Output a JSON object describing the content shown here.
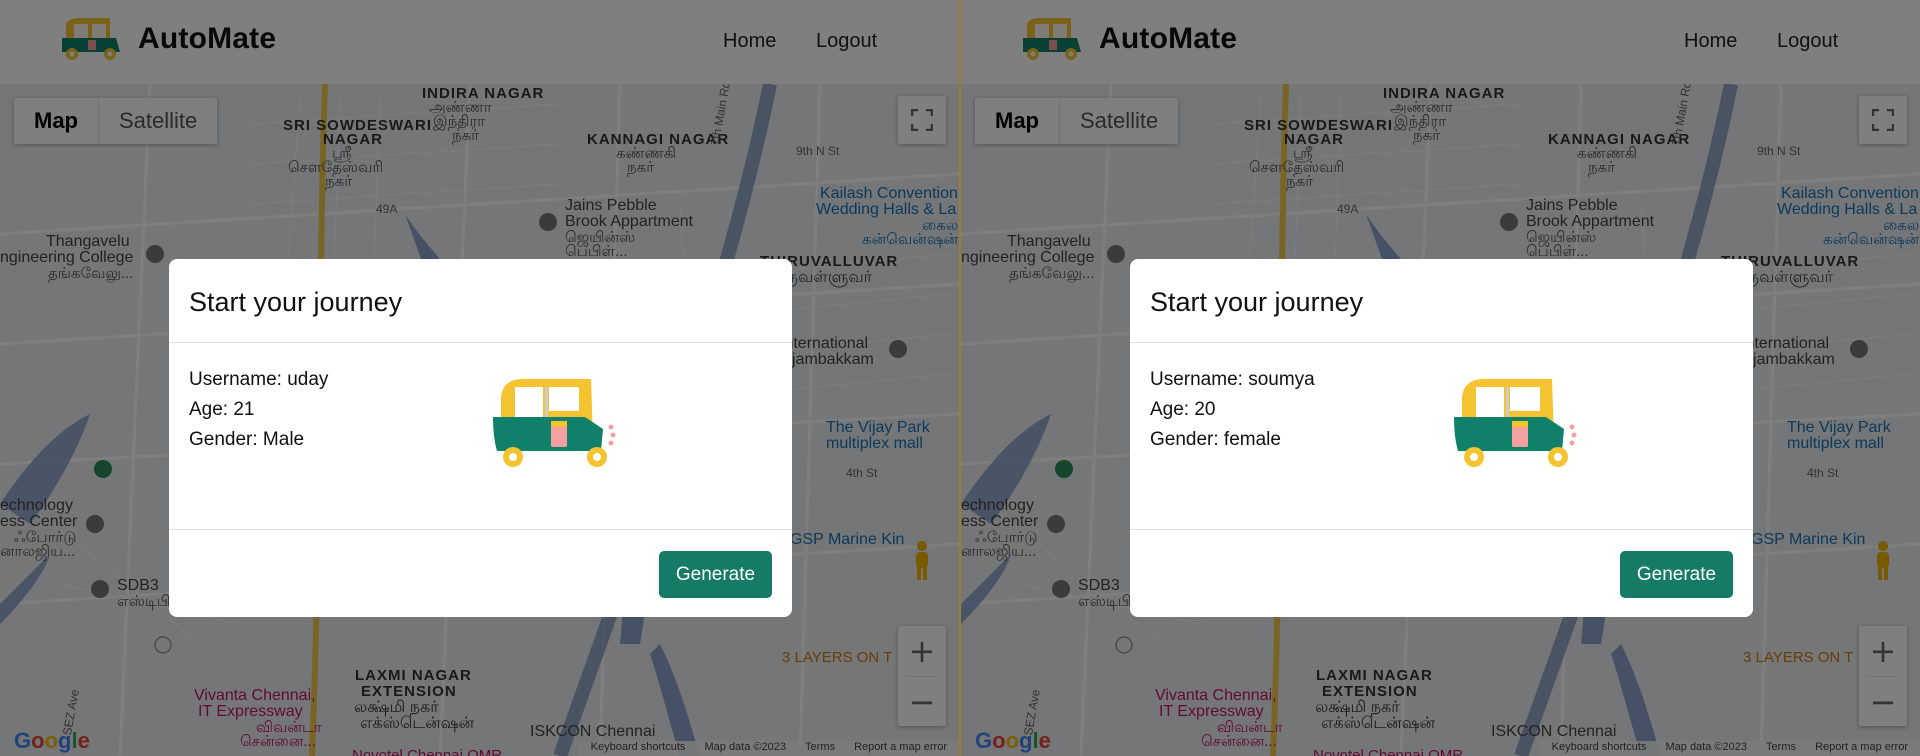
{
  "app": {
    "brand": "AutoMate",
    "nav": {
      "home": "Home",
      "logout": "Logout"
    },
    "accent_color": "#157a66"
  },
  "map": {
    "type_map": "Map",
    "type_satellite": "Satellite",
    "google_logo": "Google",
    "zoom_in": "+",
    "zoom_out": "−",
    "attribution": [
      "Keyboard shortcuts",
      "Map data ©2023",
      "Terms",
      "Report a map error"
    ],
    "labels": {
      "indira1": "INDIRA NAGAR",
      "indira2": "அண்ணா",
      "indira3": "இந்திரா",
      "indira4": "நகர்",
      "sri1": "SRI SOWDESWARI",
      "sri2": "NAGAR",
      "sri3": "ஸ்ரீ",
      "sri4": "சௌதேஸ்வரி",
      "sri5": "நகர்",
      "kannagi1": "KANNAGI NAGAR",
      "kannagi2": "கண்ணகி",
      "kannagi3": "நகர்",
      "main7": "7th Main Rd",
      "st9": "9th N St",
      "hw": "49A",
      "jains1": "Jains Pebble",
      "jains2": "Brook Appartment",
      "jains3": "ஜெயின்ஸ்",
      "jains4": "பெபிள்...",
      "kailash1": "Kailash Convention",
      "kailash2": "Wedding Halls & La",
      "kailash3": "கைல",
      "kailash4": "கன்வென்ஷன்...",
      "thang1": "Thangavelu",
      "thang2": "ngineering College",
      "thang3": "தங்கவேலு...",
      "thiru1": "THIRUVALLUVAR",
      "thiru2": "திருவள்ளுவர்",
      "intl1": "International",
      "intl2": "jambakkam",
      "vijay1": "The Vijay Park",
      "vijay2": "multiplex mall",
      "st4": "4th St",
      "tech1": "echnology",
      "tech2": "ess Center",
      "tech3": "ஃபோர்டு",
      "tech4": "னாலஜிய...",
      "sdb1": "SDB3",
      "sdb2": "எஸ்டிபி",
      "gsp": "GSP Marine Kin",
      "sez": "SEZ Ave",
      "layers": "3 LAYERS ON T",
      "laxmi1": "LAXMI NAGAR",
      "laxmi2": "EXTENSION",
      "laxmi3": "லக்ஷ்மி நகர்",
      "laxmi4": "எக்ஸ்டென்ஷன்",
      "vivanta1": "Vivanta Chennai,",
      "vivanta2": "IT Expressway",
      "vivanta3": "விவன்டா",
      "vivanta4": "சென்னை...",
      "iskcon": "ISKCON Chennai",
      "novotel": "Novotel Chennai OMR"
    }
  },
  "modal_title": "Start your journey",
  "generate_label": "Generate",
  "users": [
    {
      "username_line": "Username: uday",
      "age_line": "Age: 21",
      "gender_line": "Gender: Male"
    },
    {
      "username_line": "Username: soumya",
      "age_line": "Age: 20",
      "gender_line": "Gender: female"
    }
  ]
}
